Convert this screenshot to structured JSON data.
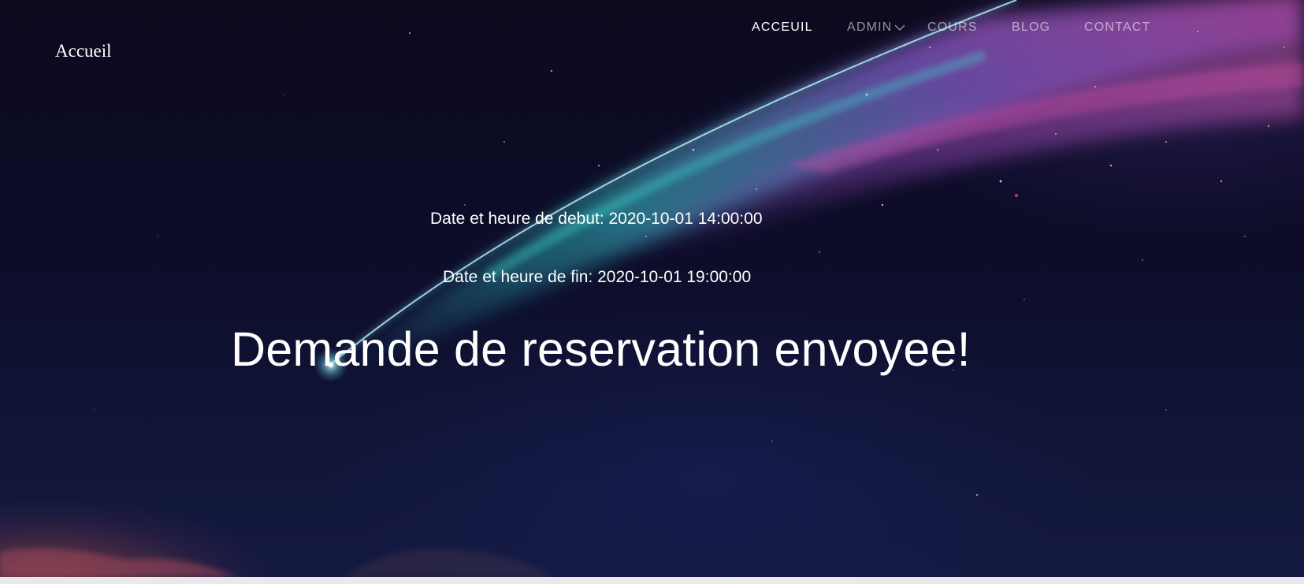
{
  "brand": {
    "label": "Accueil"
  },
  "nav": {
    "items": [
      {
        "label": "ACCEUIL",
        "active": true
      },
      {
        "label": "ADMIN",
        "active": false,
        "has_dropdown": true,
        "dropdown_icon": "chevron-down-icon"
      },
      {
        "label": "COURS",
        "active": false
      },
      {
        "label": "BLOG",
        "active": false
      },
      {
        "label": "CONTACT",
        "active": false
      }
    ]
  },
  "reservation": {
    "start_line": "Date et heure de debut: 2020-10-01 14:00:00",
    "end_line": "Date et heure de fin: 2020-10-01 19:00:00",
    "confirmation": "Demande de reservation envoyee!"
  },
  "colors": {
    "text": "#ffffff",
    "nav_inactive": "rgba(255,255,255,0.55)",
    "sky_dark": "#0b0a1e",
    "comet_cyan": "#3fc9c9",
    "comet_magenta": "#b04fb8",
    "footer": "#e9e9ea"
  }
}
